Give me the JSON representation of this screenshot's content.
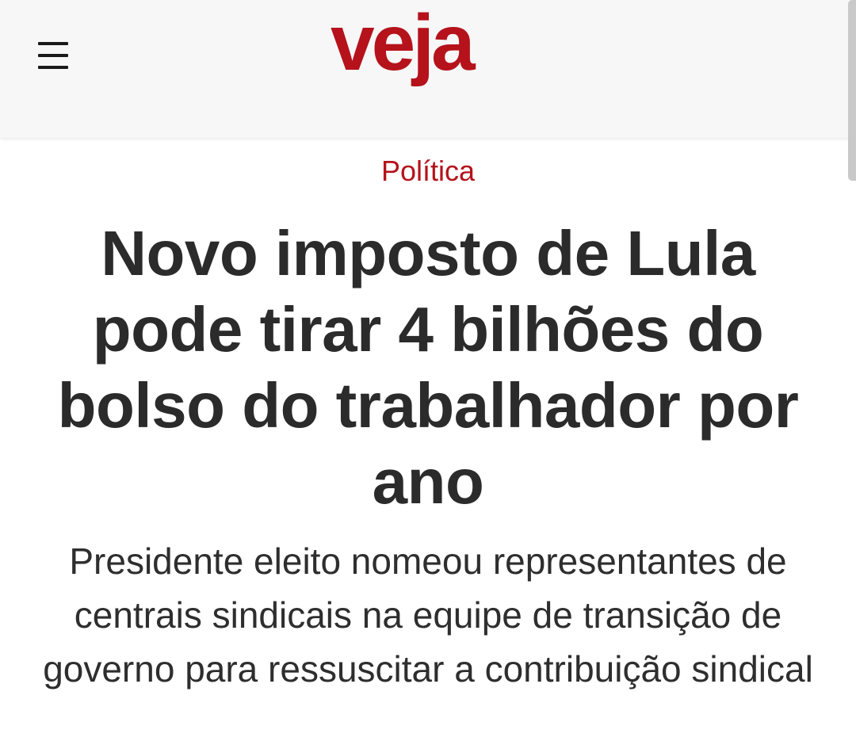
{
  "header": {
    "menu_icon": "hamburger-menu-icon",
    "logo_text": "veja",
    "logo_color": "#b5121b"
  },
  "article": {
    "category": "Política",
    "headline": "Novo imposto de Lula pode tirar 4 bilhões do bolso do trabalhador por ano",
    "subheadline": "Presidente eleito nomeou representantes de centrais sindicais na equipe de transição de governo para ressuscitar a contribuição sindical"
  },
  "colors": {
    "accent": "#b5121b",
    "text": "#2b2b2b",
    "header_bg": "#f7f7f7"
  }
}
